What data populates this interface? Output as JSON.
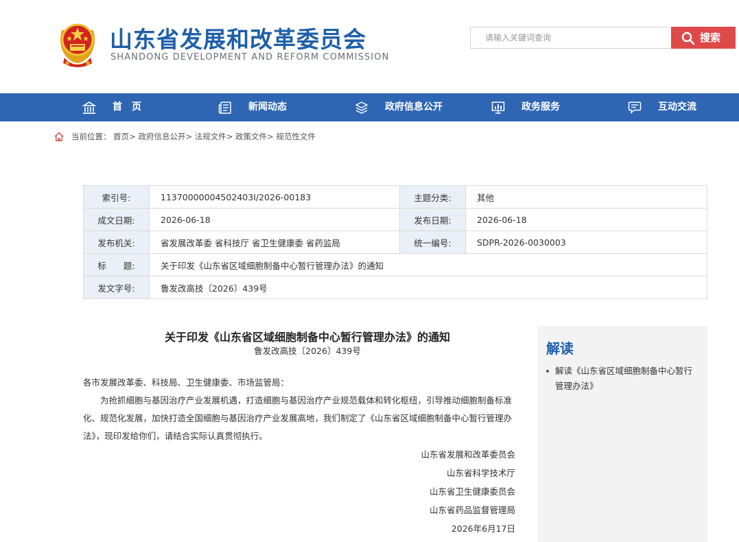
{
  "header": {
    "site_title": "山东省发展和改革委员会",
    "site_subtitle": "SHANDONG DEVELOPMENT AND REFORM COMMISSION",
    "search_placeholder": "请输入关键词查询",
    "search_button": "搜索",
    "emblem_icon": "national-emblem-icon"
  },
  "nav": {
    "items": [
      {
        "label": "首　页",
        "icon": "home-building-icon"
      },
      {
        "label": "新闻动态",
        "icon": "news-icon"
      },
      {
        "label": "政府信息公开",
        "icon": "layers-icon"
      },
      {
        "label": "政务服务",
        "icon": "chart-monitor-icon"
      },
      {
        "label": "互动交流",
        "icon": "chat-icon"
      }
    ]
  },
  "breadcrumb": {
    "prefix": "当前位置：",
    "items": [
      "首页",
      "政府信息公开",
      "法规文件",
      "政策文件",
      "规范性文件"
    ],
    "separator": ">"
  },
  "info": {
    "index_label": "索引号:",
    "index_value": "11370000004502403I/2026-00183",
    "topic_label": "主题分类:",
    "topic_value": "其他",
    "created_label": "成文日期:",
    "created_value": "2026-06-18",
    "published_label": "发布日期:",
    "published_value": "2026-06-18",
    "issuer_label": "发布机关:",
    "issuer_value": "省发展改革委 省科技厅 省卫生健康委 省药监局",
    "code_label": "统一编号:",
    "code_value": "SDPR-2026-0030003",
    "title_label": "标　　题:",
    "title_value": "关于印发《山东省区域细胞制备中心暂行管理办法》的通知",
    "docno_label": "发文字号:",
    "docno_value": "鲁发改高技〔2026〕439号"
  },
  "article": {
    "title": "关于印发《山东省区域细胞制备中心暂行管理办法》的通知",
    "doc_number": "鲁发改高技〔2026〕439号",
    "salutation": "各市发展改革委、科技局、卫生健康委、市场监管局：",
    "body": "为抢抓细胞与基因治疗产业发展机遇，打造细胞与基因治疗产业规范载体和转化枢纽，引导推动细胞制备标准化、规范化发展，加快打造全国细胞与基因治疗产业发展高地，我们制定了《山东省区域细胞制备中心暂行管理办法》，现印发给你们，请结合实际认真贯彻执行。",
    "signatures": [
      "山东省发展和改革委员会",
      "山东省科学技术厅",
      "山东省卫生健康委员会",
      "山东省药品监督管理局"
    ],
    "date": "2026年6月17日"
  },
  "sidebar": {
    "title": "解读",
    "items": [
      "解读《山东省区域细胞制备中心暂行管理办法》"
    ]
  },
  "colors": {
    "brand_blue": "#1e5fa8",
    "nav_bg": "#2e66b3",
    "search_red": "#dd4a49",
    "table_key_bg": "#eaf0f7",
    "sidebar_bg": "#f3f3f3"
  }
}
